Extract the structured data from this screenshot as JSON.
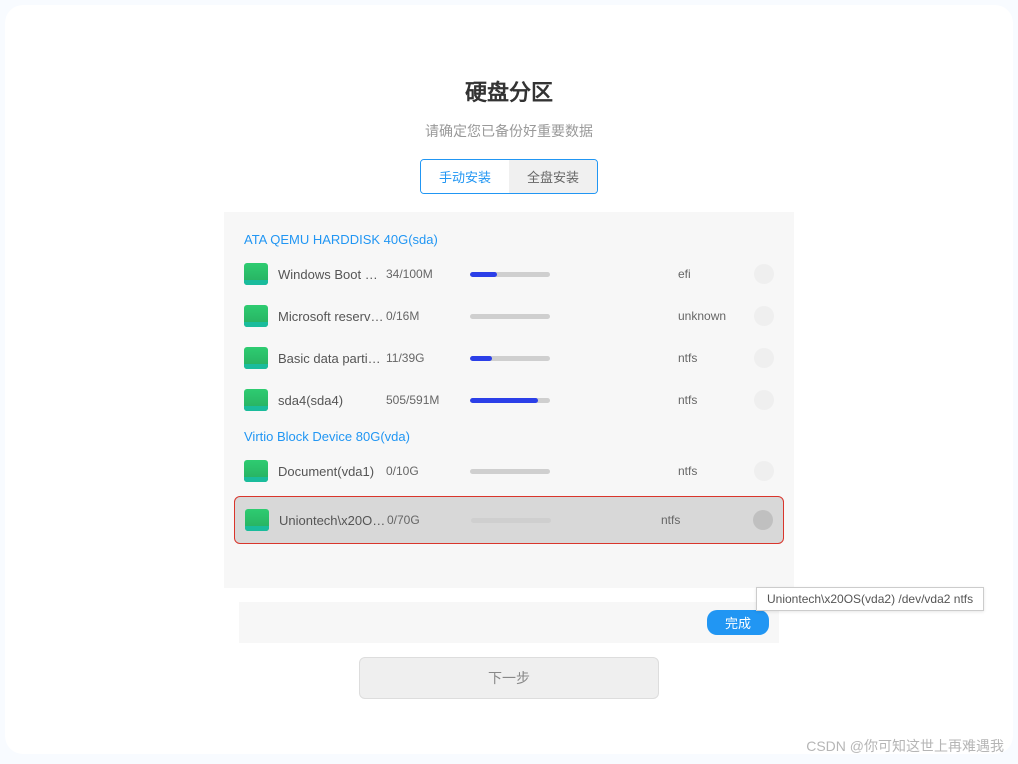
{
  "header": {
    "title": "硬盘分区",
    "subtitle": "请确定您已备份好重要数据"
  },
  "tabs": {
    "manual": "手动安装",
    "full": "全盘安装"
  },
  "disks": [
    {
      "label": "ATA  QEMU  HARDDISK  40G(sda)",
      "partitions": [
        {
          "name": "Windows  Boot  …",
          "size": "34/100M",
          "progress": 34,
          "fs": "efi"
        },
        {
          "name": "Microsoft  reserv…",
          "size": "0/16M",
          "progress": 0,
          "fs": "unknown"
        },
        {
          "name": "Basic  data  parti…",
          "size": "11/39G",
          "progress": 28,
          "fs": "ntfs"
        },
        {
          "name": "sda4(sda4)",
          "size": "505/591M",
          "progress": 85,
          "fs": "ntfs"
        }
      ]
    },
    {
      "label": "Virtio  Block  Device  80G(vda)",
      "partitions": [
        {
          "name": "Document(vda1)",
          "size": "0/10G",
          "progress": 0,
          "fs": "ntfs"
        },
        {
          "name": "Uniontech\\x20O…",
          "size": "0/70G",
          "progress": 0,
          "fs": "ntfs",
          "highlighted": true
        }
      ]
    }
  ],
  "buttons": {
    "done": "完成",
    "next": "下一步"
  },
  "tooltip": "Uniontech\\x20OS(vda2)    /dev/vda2    ntfs",
  "watermark": "CSDN @你可知这世上再难遇我"
}
